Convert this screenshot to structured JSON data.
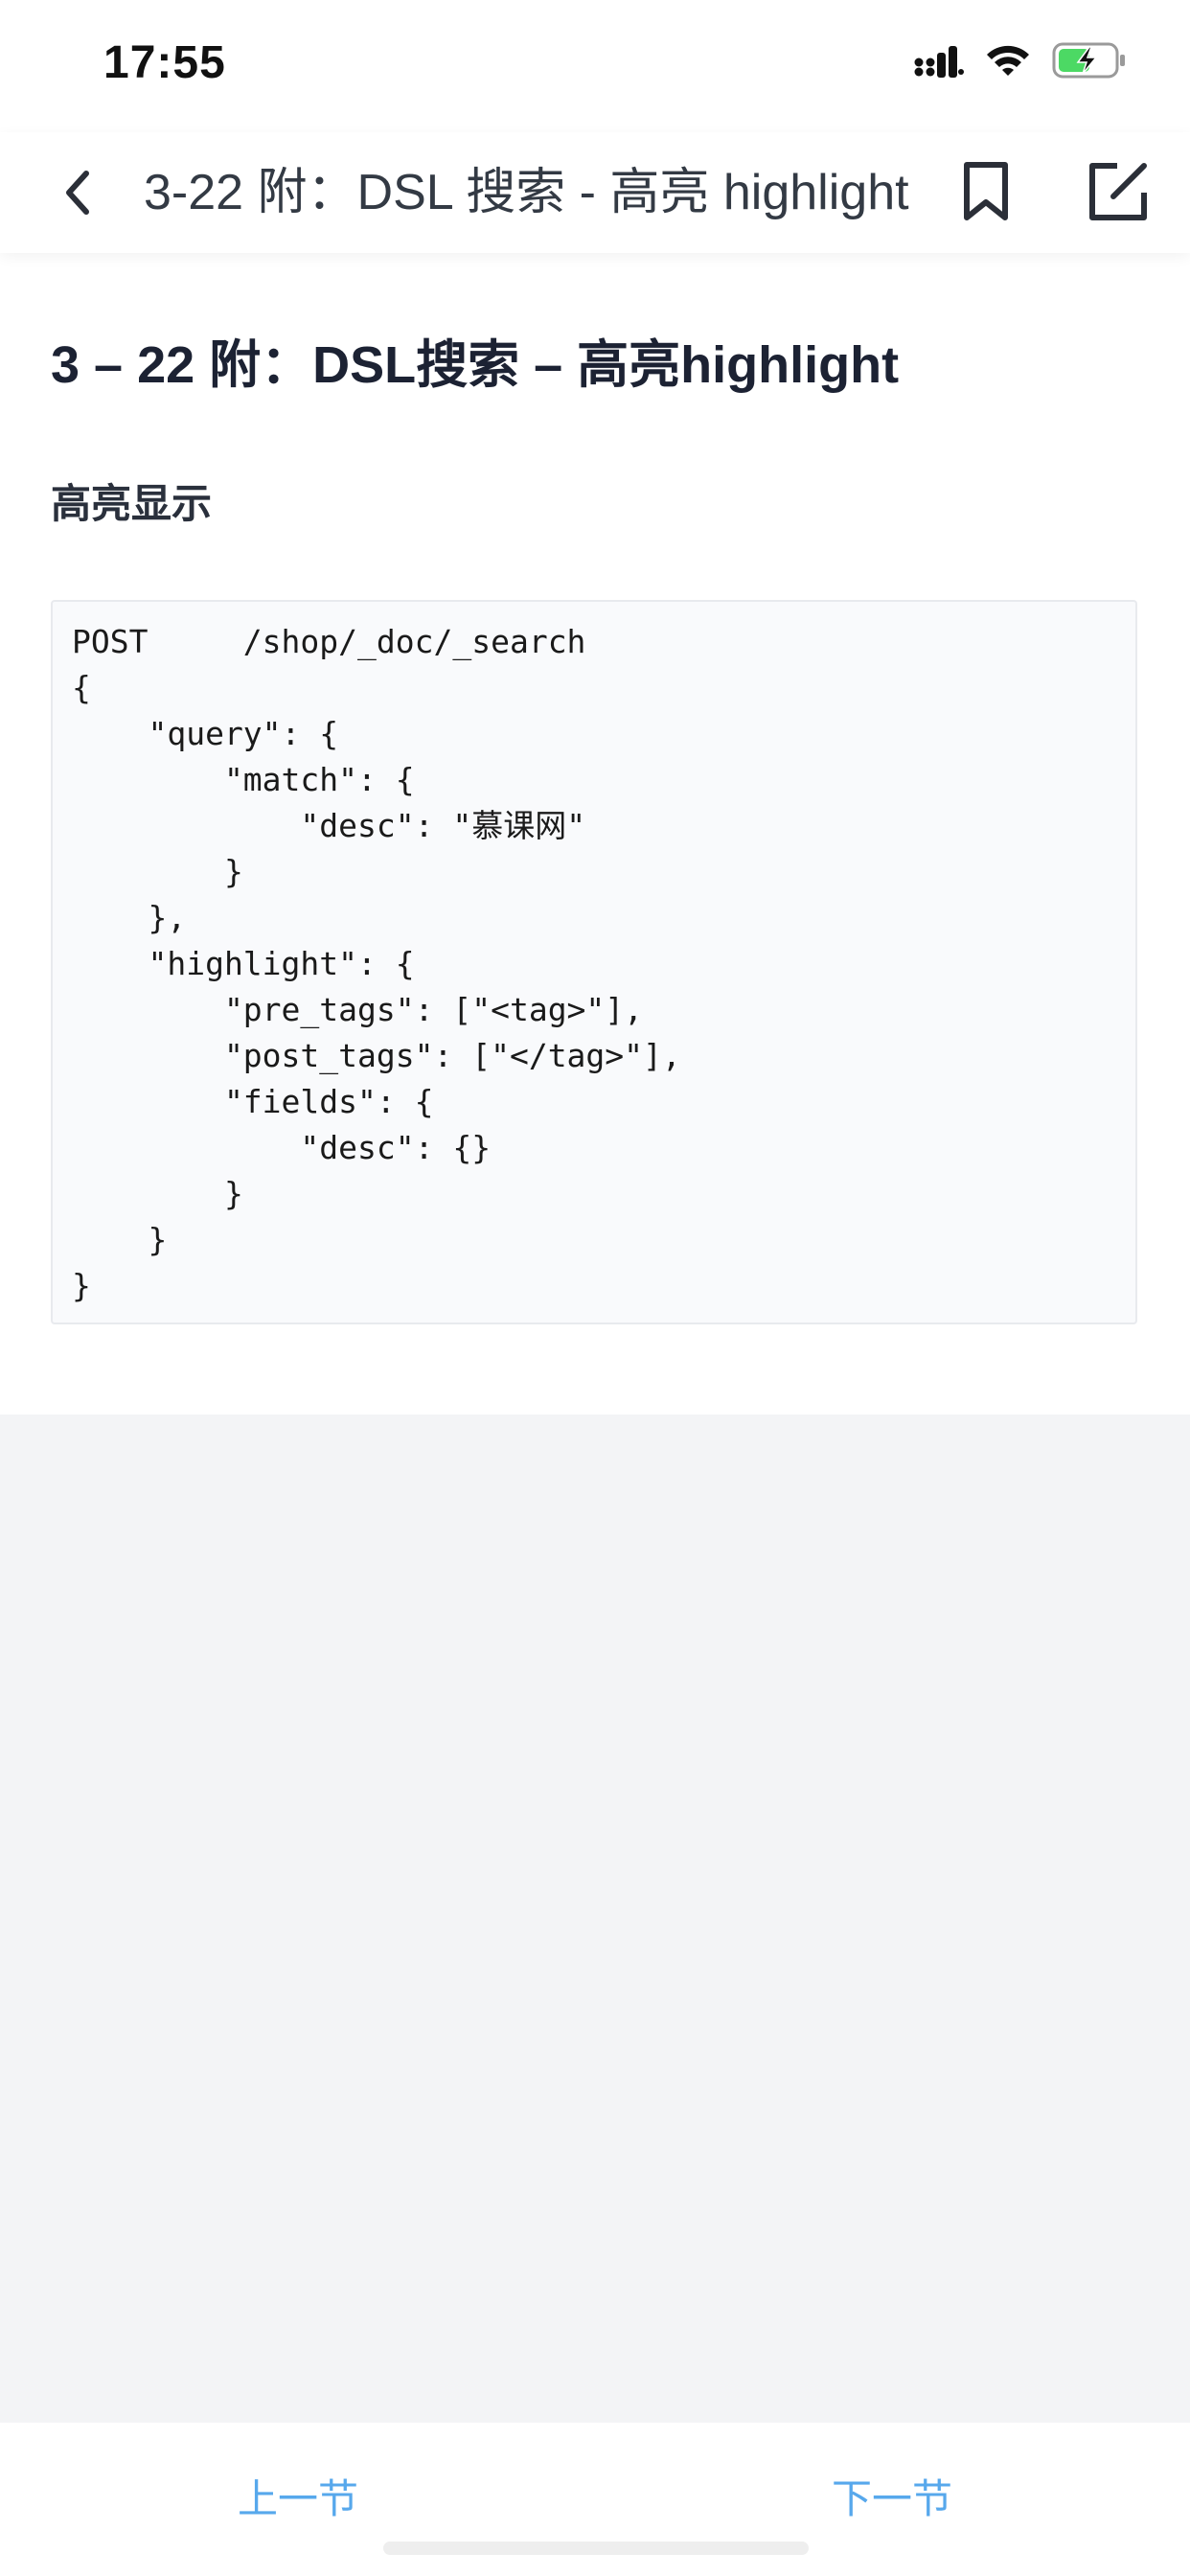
{
  "status_bar": {
    "time": "17:55",
    "icons": [
      "cellular-signal-icon",
      "wifi-icon",
      "battery-charging-icon"
    ],
    "battery_color": "#4cd964"
  },
  "nav": {
    "title": "3-22 附：DSL 搜索 - 高亮 highlight",
    "icons": [
      "back-chevron-icon",
      "bookmark-icon",
      "edit-note-icon"
    ]
  },
  "article": {
    "title": "3 – 22 附：DSL搜索 – 高亮highlight",
    "section_heading": "高亮显示",
    "code_lines": [
      "POST     /shop/_doc/_search",
      "{",
      "    \"query\": {",
      "        \"match\": {",
      "            \"desc\": \"慕课网\"",
      "        }",
      "    },",
      "    \"highlight\": {",
      "        \"pre_tags\": [\"<tag>\"],",
      "        \"post_tags\": [\"</tag>\"],",
      "        \"fields\": {",
      "            \"desc\": {}",
      "        }",
      "    }",
      "}"
    ]
  },
  "bottom_bar": {
    "prev_label": "上一节",
    "next_label": "下一节",
    "accent_color": "#57a8ec"
  }
}
